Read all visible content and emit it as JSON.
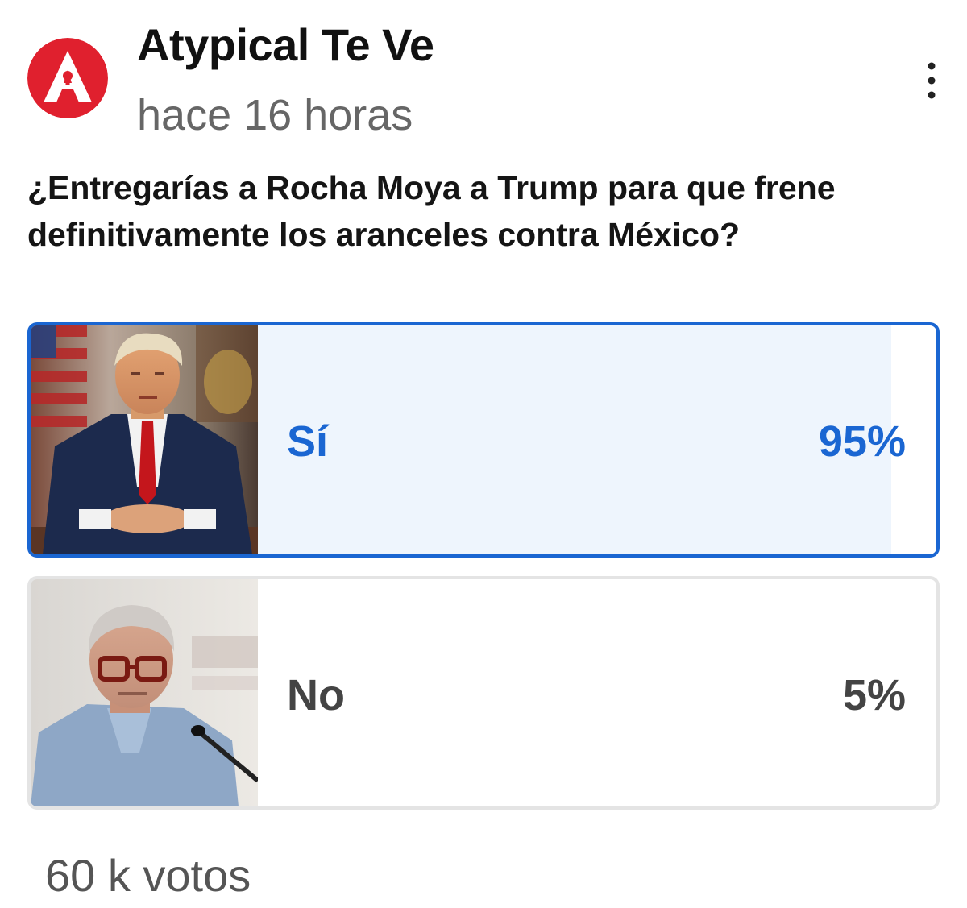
{
  "post": {
    "channel_name": "Atypical Te Ve",
    "timestamp": "hace 16 horas",
    "logo_letter": "A",
    "brand_color": "#e0202e"
  },
  "menu": {
    "icon": "more-vertical-icon"
  },
  "poll": {
    "question": "¿Entregarías a Rocha Moya a Trump para que frene definitivamente los aranceles contra México?",
    "accent_color": "#1a66d2",
    "options": [
      {
        "label": "Sí",
        "percent_text": "95%",
        "percent": 95,
        "selected": true
      },
      {
        "label": "No",
        "percent_text": "5%",
        "percent": 5,
        "selected": false
      }
    ],
    "votes": "60 k votos"
  }
}
